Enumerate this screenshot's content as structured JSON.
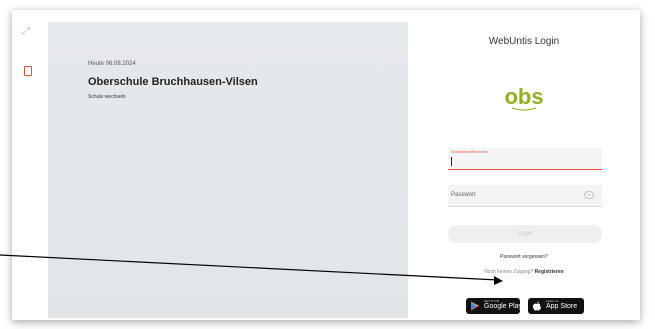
{
  "hero": {
    "date": "Heute 06.08.2024",
    "school_name": "Oberschule Bruchhausen-Vilsen",
    "switch_school": "Schule wechseln"
  },
  "login": {
    "title": "WebUntis Login",
    "logo_text": "obs",
    "username_label": "Schulname/Benutzer",
    "password_placeholder": "Passwort",
    "login_button": "Login",
    "forgot_password": "Passwort vergessen?",
    "no_access": "Noch keinen Zugang?",
    "register": "Registrieren"
  },
  "stores": {
    "google_small": "GET IT ON",
    "google_big": "Google Play",
    "apple_small": "Laden im",
    "apple_big": "App Store"
  },
  "colors": {
    "accent": "#e5533f",
    "logo_green": "#8fb31d",
    "hero_bg": "#e3e7ea"
  }
}
